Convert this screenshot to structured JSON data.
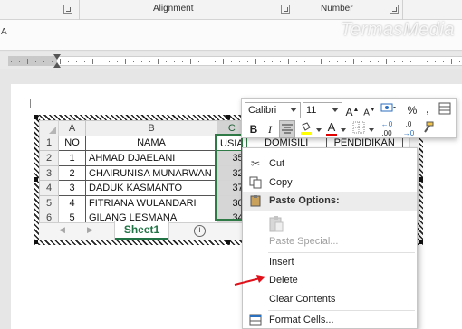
{
  "ribbon": {
    "groups": [
      "Alignment",
      "Number"
    ]
  },
  "style_strip": {
    "label": "A"
  },
  "watermark": "TermasMedia",
  "spreadsheet": {
    "columns": [
      "A",
      "B",
      "C"
    ],
    "rows": [
      "1",
      "2",
      "3",
      "4",
      "5",
      "6"
    ],
    "header": {
      "no": "NO",
      "nama": "NAMA",
      "usia": "USIA",
      "domisili": "DOMISILI",
      "pendidikan": "PENDIDIKAN"
    },
    "records": [
      {
        "no": "1",
        "nama": "AHMAD DJAELANI",
        "usia": "35"
      },
      {
        "no": "2",
        "nama": "CHAIRUNISA MUNARWAN",
        "usia": "32"
      },
      {
        "no": "3",
        "nama": "DADUK KASMANTO",
        "usia": "37"
      },
      {
        "no": "4",
        "nama": "FITRIANA WULANDARI",
        "usia": "30"
      },
      {
        "no": "5",
        "nama": "GILANG LESMANA",
        "usia": "34"
      }
    ],
    "sheet_tab": "Sheet1"
  },
  "mini_toolbar": {
    "font_name": "Calibri",
    "font_size": "11",
    "grow_font": "A",
    "shrink_font": "A",
    "percent": "%",
    "comma": ",",
    "bold": "B",
    "italic": "I",
    "font_color_letter": "A",
    "increase_decimal": ".00",
    "decrease_decimal": ".0",
    "fill_color": "#ffff00",
    "font_color": "#e00000"
  },
  "context_menu": {
    "cut": "Cut",
    "copy": "Copy",
    "paste_options": "Paste Options:",
    "paste_special": "Paste Special...",
    "insert": "Insert",
    "delete": "Delete",
    "clear_contents": "Clear Contents",
    "format_cells": "Format Cells..."
  },
  "colors": {
    "excel_green": "#217346",
    "selection_green": "#2f7a46",
    "arrow_red": "#e0101a"
  }
}
